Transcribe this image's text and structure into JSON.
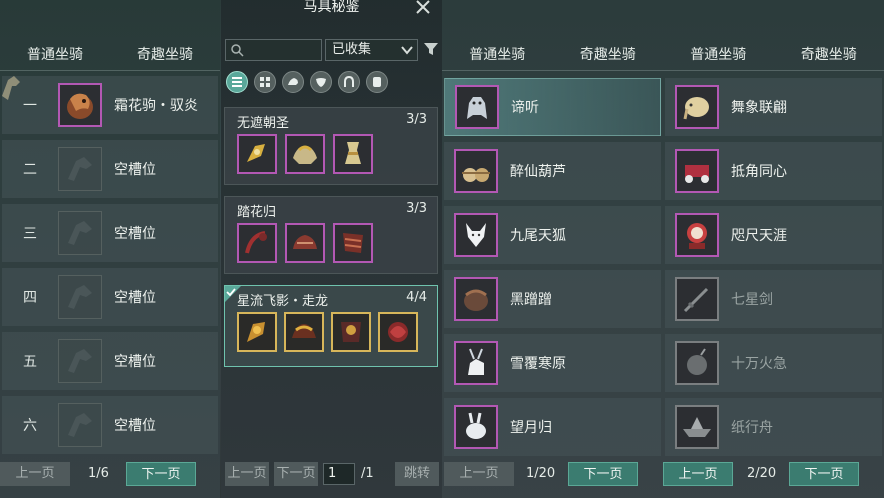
{
  "tabs": {
    "normal": "普通坐骑",
    "fun": "奇趣坐骑"
  },
  "left_panel": {
    "rows": [
      {
        "num": "一",
        "label": "霜花驹・驭炎",
        "filled": true,
        "icon": "horse-icon"
      },
      {
        "num": "二",
        "label": "空槽位",
        "filled": false
      },
      {
        "num": "三",
        "label": "空槽位",
        "filled": false
      },
      {
        "num": "四",
        "label": "空槽位",
        "filled": false
      },
      {
        "num": "五",
        "label": "空槽位",
        "filled": false
      },
      {
        "num": "六",
        "label": "空槽位",
        "filled": false
      }
    ],
    "pager": {
      "prev": "上一页",
      "info": "1/6",
      "next": "下一页"
    }
  },
  "middle_panel": {
    "title": "马具秘鉴",
    "search_placeholder": "",
    "dropdown_value": "已收集",
    "categories": [
      "list-icon",
      "grid-icon",
      "saddle-icon",
      "armor-icon",
      "horseshoe-icon",
      "scroll-icon"
    ],
    "sets": [
      {
        "name": "无遮朝圣",
        "count": "3/3",
        "items": [
          "bridle-icon",
          "saddle-icon",
          "vase-icon"
        ],
        "complete": false
      },
      {
        "name": "踏花归",
        "count": "3/3",
        "items": [
          "bridle-icon",
          "saddle-icon",
          "armor-icon"
        ],
        "complete": false
      },
      {
        "name": "星流飞影・走龙",
        "count": "4/4",
        "items": [
          "bridle-icon",
          "saddle-icon",
          "armor-icon",
          "ornament-icon"
        ],
        "complete": true
      }
    ],
    "pager": {
      "prev": "上一页",
      "next": "下一页",
      "page": "1",
      "total": "/1",
      "jump": "跳转"
    }
  },
  "right_panel_a": {
    "rows": [
      {
        "label": "谛听",
        "icon": "beast-icon",
        "owned": true,
        "selected": true
      },
      {
        "label": "醉仙葫芦",
        "icon": "gourd-icon",
        "owned": true
      },
      {
        "label": "九尾天狐",
        "icon": "fox-icon",
        "owned": true
      },
      {
        "label": "黑蹭蹭",
        "icon": "pot-icon",
        "owned": true
      },
      {
        "label": "雪覆寒原",
        "icon": "deer-icon",
        "owned": true
      },
      {
        "label": "望月归",
        "icon": "rabbit-icon",
        "owned": true
      }
    ],
    "pager": {
      "prev": "上一页",
      "info": "1/20",
      "next": "下一页"
    }
  },
  "right_panel_b": {
    "rows": [
      {
        "label": "舞象联翩",
        "icon": "elephant-icon",
        "owned": true
      },
      {
        "label": "抵角同心",
        "icon": "cart-icon",
        "owned": true
      },
      {
        "label": "咫尺天涯",
        "icon": "lion-icon",
        "owned": true
      },
      {
        "label": "七星剑",
        "icon": "sword-icon",
        "owned": false
      },
      {
        "label": "十万火急",
        "icon": "bomb-icon",
        "owned": false
      },
      {
        "label": "纸行舟",
        "icon": "paper-boat-icon",
        "owned": false
      }
    ],
    "pager": {
      "prev": "上一页",
      "info": "2/20",
      "next": "下一页"
    }
  }
}
